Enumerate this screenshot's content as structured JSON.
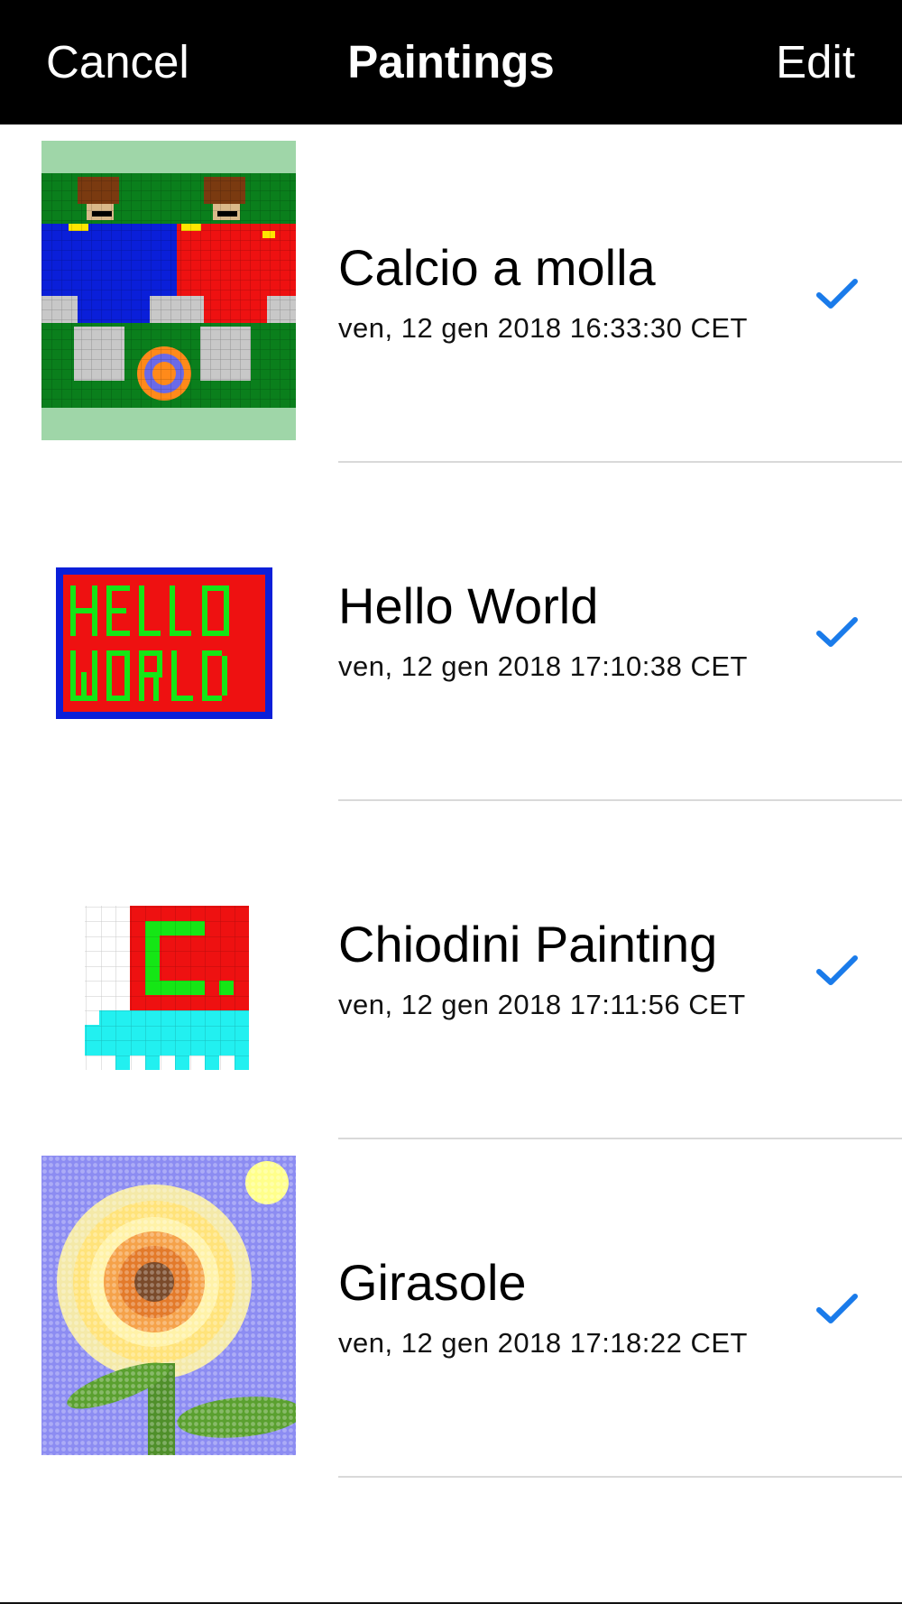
{
  "navbar": {
    "cancel_label": "Cancel",
    "title": "Paintings",
    "edit_label": "Edit"
  },
  "paintings": [
    {
      "title": "Calcio a molla",
      "date": "ven, 12 gen 2018 16:33:30 CET",
      "selected": true
    },
    {
      "title": "Hello World",
      "date": "ven, 12 gen 2018 17:10:38 CET",
      "selected": true
    },
    {
      "title": "Chiodini Painting",
      "date": "ven, 12 gen 2018 17:11:56 CET",
      "selected": true
    },
    {
      "title": "Girasole",
      "date": "ven, 12 gen 2018 17:18:22 CET",
      "selected": true
    }
  ],
  "colors": {
    "navbar_bg": "#000000",
    "accent": "#1a7bea",
    "separator": "#d9d9d9"
  },
  "icons": {
    "checkmark": "checkmark-icon"
  }
}
